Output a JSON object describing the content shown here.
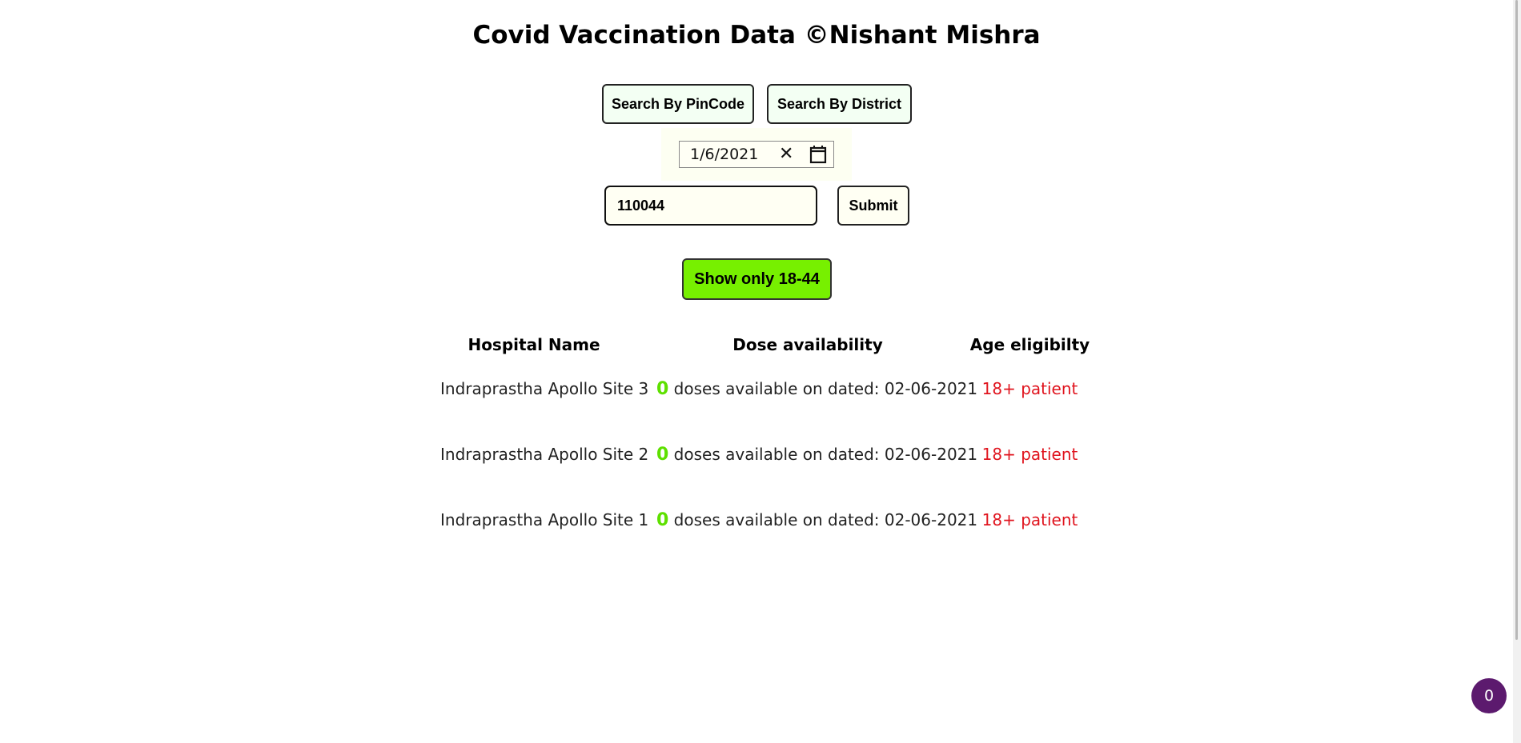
{
  "header": {
    "title": "Covid Vaccination Data ©Nishant Mishra"
  },
  "search_tabs": {
    "pincode_label": "Search By PinCode",
    "district_label": "Search By District"
  },
  "date_picker": {
    "value": "1/6/2021",
    "clear_icon": "close-icon",
    "calendar_icon": "calendar-icon"
  },
  "search": {
    "pincode_value": "110044",
    "submit_label": "Submit"
  },
  "filter": {
    "label": "Show only 18-44",
    "color": "#77f000"
  },
  "table": {
    "headers": [
      "Hospital Name",
      "Dose availability",
      "Age eligibilty"
    ],
    "rows": [
      {
        "hospital": "Indraprastha Apollo Site 3",
        "dose_count": "0",
        "dose_text": "doses available on dated: 02-06-2021",
        "age": "18+ patient"
      },
      {
        "hospital": "Indraprastha Apollo Site 2",
        "dose_count": "0",
        "dose_text": "doses available on dated: 02-06-2021",
        "age": "18+ patient"
      },
      {
        "hospital": "Indraprastha Apollo Site 1",
        "dose_count": "0",
        "dose_text": "doses available on dated: 02-06-2021",
        "age": "18+ patient"
      }
    ]
  },
  "notification_badge": {
    "count": "0",
    "color": "#5c1a6e"
  },
  "colors": {
    "age_text": "#e0141e",
    "dose_count": "#5ee000"
  }
}
